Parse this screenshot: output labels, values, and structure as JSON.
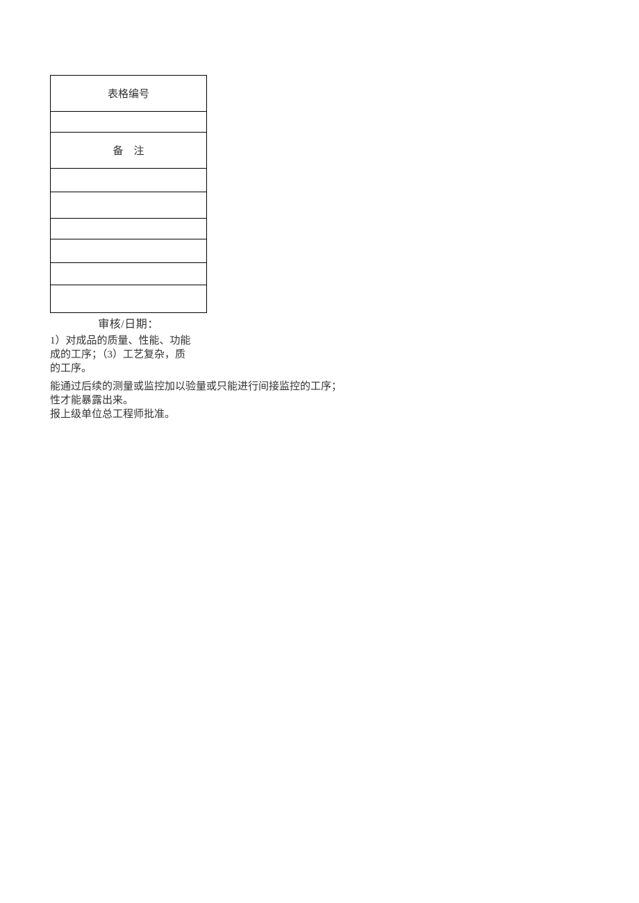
{
  "table": {
    "header1": "表格编号",
    "header2": "备　注"
  },
  "caption": "审核/日期：",
  "body": {
    "p1_l1": "1）对成品的质量、性能、功能",
    "p1_l2": "成的工序；（3）工艺复杂，质",
    "p1_l3": "的工序。",
    "p2_l1": "能通过后续的测量或监控加以验量或只能进行间接监控的工序；",
    "p2_l2": "性才能暴露出来。",
    "p2_l3": "报上级单位总工程师批准。"
  }
}
